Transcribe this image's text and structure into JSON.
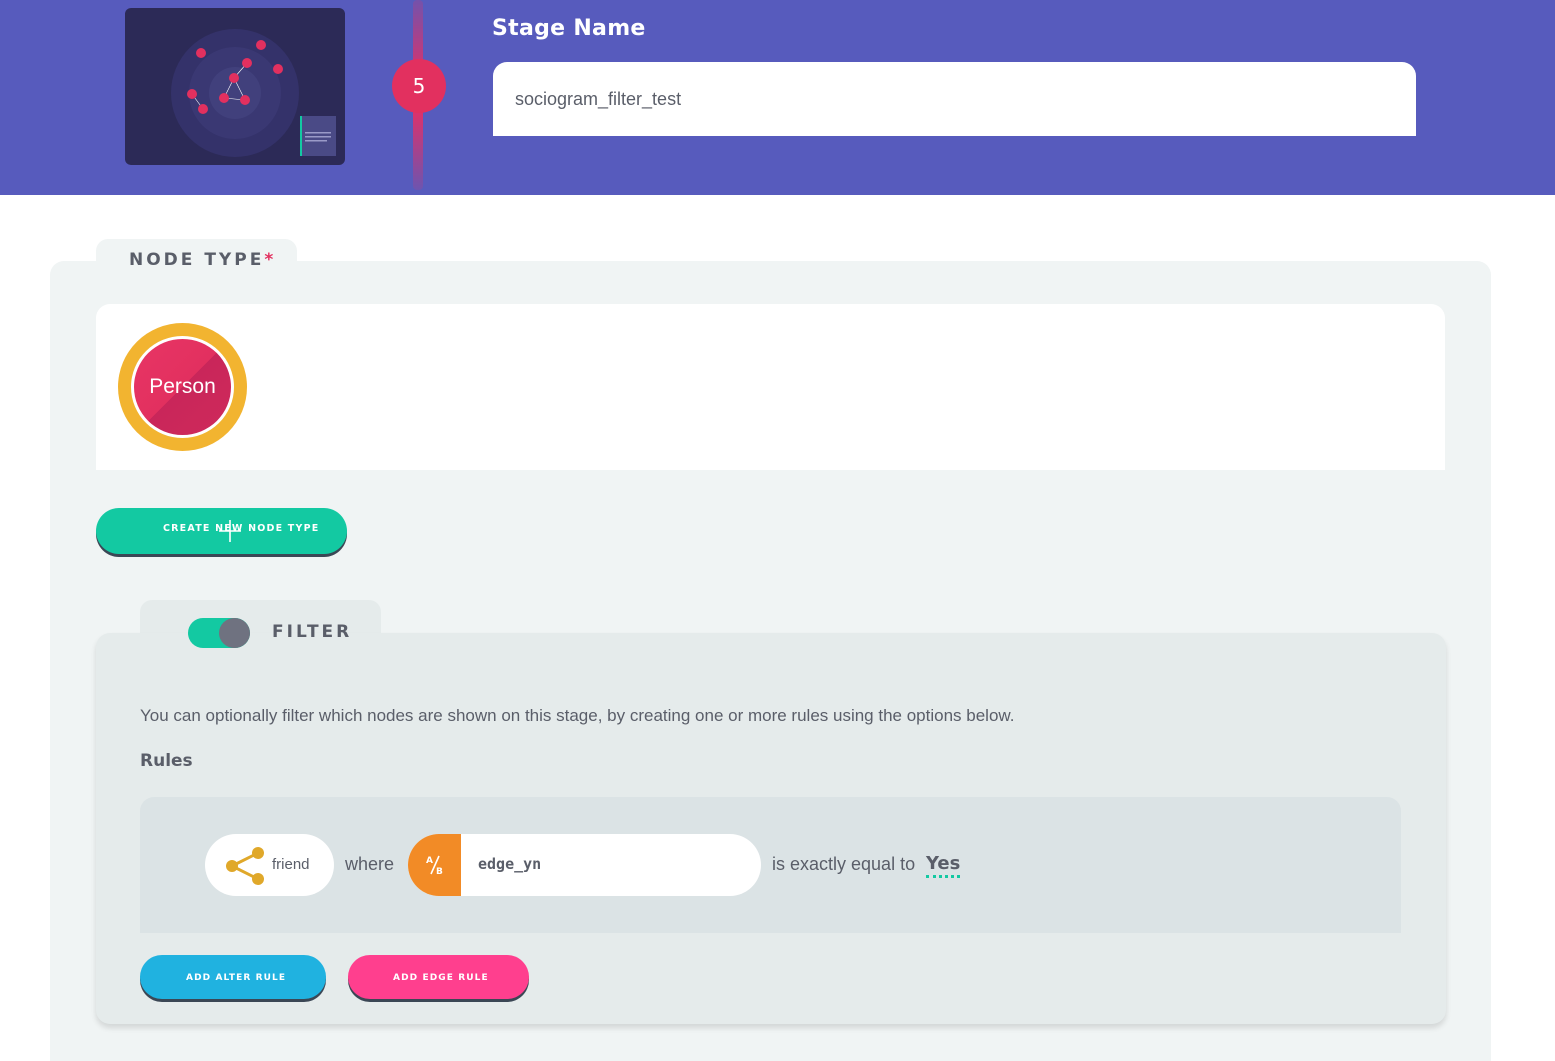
{
  "header": {
    "stage_number": "5",
    "stage_name_label": "Stage Name",
    "stage_name_value": "sociogram_filter_test"
  },
  "node_type": {
    "section_label": "NODE TYPE",
    "required_marker": "*",
    "selected_node": "Person",
    "create_button_label": "CREATE NEW NODE TYPE"
  },
  "filter": {
    "enabled": true,
    "label": "FILTER",
    "description": "You can optionally filter which nodes are shown on this stage, by creating one or more rules using the options below.",
    "rules_label": "Rules",
    "rules": [
      {
        "entity_icon": "share-icon",
        "entity": "friend",
        "joiner": "where",
        "variable_badge": "A/B",
        "variable": "edge_yn",
        "operator": "is exactly equal to",
        "value": "Yes"
      }
    ],
    "add_alter_rule_label": "ADD ALTER RULE",
    "add_edge_rule_label": "ADD EDGE RULE"
  },
  "colors": {
    "header_bg": "#575bbd",
    "accent_pink": "#e2305f",
    "accent_green": "#13c9a2",
    "node_ring": "#f2b430",
    "alter_button": "#20b2e0",
    "edge_button": "#ff3f8e",
    "variable_badge": "#f28b26"
  }
}
